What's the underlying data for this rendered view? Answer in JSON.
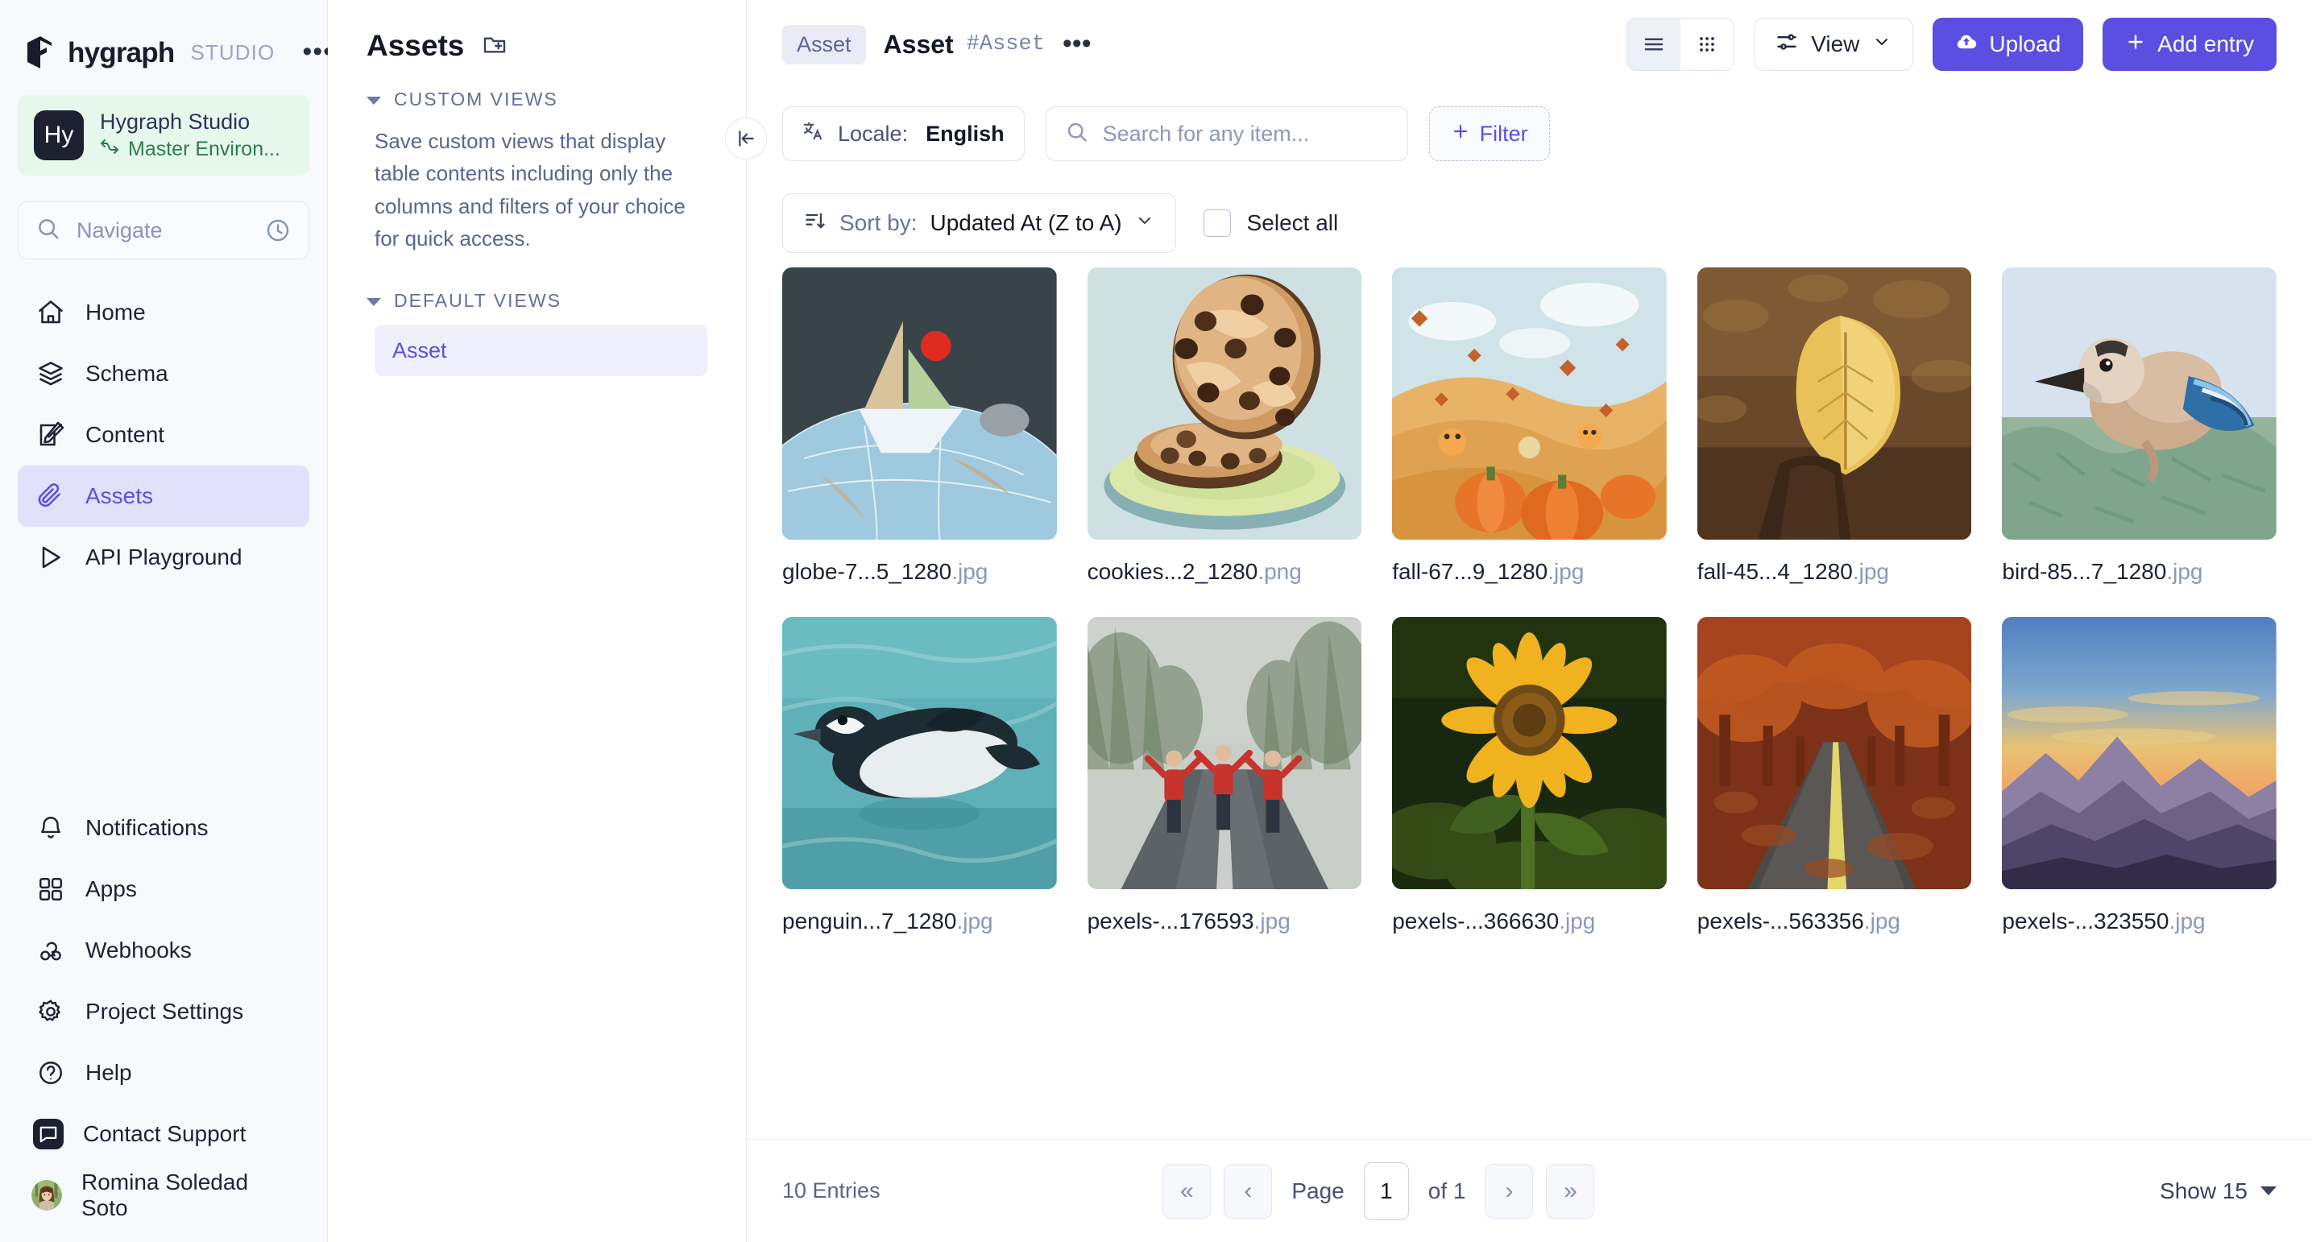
{
  "sidebar": {
    "brand": {
      "name": "hygraph",
      "suffix": "STUDIO",
      "menu_icon": "ellipsis-icon"
    },
    "project": {
      "initials": "Hy",
      "title": "Hygraph Studio",
      "environment": "Master Environ...",
      "env_color": "#2f7a4e",
      "bg_color": "#e6f7ec"
    },
    "navigate": {
      "placeholder": "Navigate",
      "search_icon": "search-icon",
      "history_icon": "clock-icon"
    },
    "items": [
      {
        "label": "Home",
        "icon": "home-icon",
        "active": false
      },
      {
        "label": "Schema",
        "icon": "layers-icon",
        "active": false
      },
      {
        "label": "Content",
        "icon": "edit-square-icon",
        "active": false
      },
      {
        "label": "Assets",
        "icon": "paperclip-icon",
        "active": true
      },
      {
        "label": "API Playground",
        "icon": "play-icon",
        "active": false
      }
    ],
    "bottom_items": [
      {
        "label": "Notifications",
        "icon": "bell-icon"
      },
      {
        "label": "Apps",
        "icon": "grid-squares-icon"
      },
      {
        "label": "Webhooks",
        "icon": "webhook-icon"
      },
      {
        "label": "Project Settings",
        "icon": "gear-icon"
      },
      {
        "label": "Help",
        "icon": "question-circle-icon"
      },
      {
        "label": "Contact Support",
        "icon": "chat-bubble-icon"
      },
      {
        "label": "Romina Soledad Soto",
        "icon": "avatar"
      }
    ],
    "active_color": "#5a4fe0",
    "active_bg": "#e2e1fb"
  },
  "views_panel": {
    "title": "Assets",
    "add_icon": "folder-plus-icon",
    "collapse_icon": "collapse-left-icon",
    "groups": [
      {
        "label": "CUSTOM VIEWS",
        "description": "Save custom views that display table contents including only the columns and filters of your choice for quick access.",
        "items": []
      },
      {
        "label": "DEFAULT VIEWS",
        "description": "",
        "items": [
          {
            "label": "Asset",
            "active": true
          }
        ]
      }
    ]
  },
  "header": {
    "breadcrumb_chip": "Asset",
    "title": "Asset",
    "hash": "#Asset",
    "more_icon": "ellipsis-icon",
    "view_mode": {
      "list_icon": "list-view-icon",
      "grid_icon": "grid-view-icon",
      "active": "grid"
    },
    "view_button": {
      "label": "View",
      "icon": "sliders-icon",
      "caret": "chevron-down-icon"
    },
    "upload_button": {
      "label": "Upload",
      "icon": "cloud-upload-icon"
    },
    "add_entry_button": {
      "label": "Add entry",
      "icon": "plus-icon"
    },
    "primary_color": "#5a4fe0"
  },
  "toolbar": {
    "locale": {
      "label": "Locale:",
      "value": "English",
      "icon": "translate-icon"
    },
    "search": {
      "value": "",
      "placeholder": "Search for any item...",
      "icon": "search-icon"
    },
    "filter": {
      "label": "Filter",
      "icon": "plus-icon"
    }
  },
  "sortbar": {
    "sort": {
      "icon": "sort-icon",
      "label": "Sort by:",
      "value": "Updated At (Z to A)",
      "caret": "chevron-down-icon"
    },
    "select_all": {
      "label": "Select all",
      "checked": false
    }
  },
  "assets": [
    {
      "name": "globe-7...5_1280",
      "ext": ".jpg",
      "thumb": "globe-paper-boat"
    },
    {
      "name": "cookies...2_1280",
      "ext": ".png",
      "thumb": "cookies-plate"
    },
    {
      "name": "fall-67...9_1280",
      "ext": ".jpg",
      "thumb": "fall-illustration"
    },
    {
      "name": "fall-45...4_1280",
      "ext": ".jpg",
      "thumb": "autumn-leaf-hand"
    },
    {
      "name": "bird-85...7_1280",
      "ext": ".jpg",
      "thumb": "jay-bird"
    },
    {
      "name": "penguin...7_1280",
      "ext": ".jpg",
      "thumb": "penguin-swim"
    },
    {
      "name": "pexels-...176593",
      "ext": ".jpg",
      "thumb": "three-people-road"
    },
    {
      "name": "pexels-...366630",
      "ext": ".jpg",
      "thumb": "sunflower"
    },
    {
      "name": "pexels-...563356",
      "ext": ".jpg",
      "thumb": "autumn-road"
    },
    {
      "name": "pexels-...323550",
      "ext": ".jpg",
      "thumb": "mountain-sunset"
    }
  ],
  "footer": {
    "entries": "10 Entries",
    "first_icon": "double-chevron-left-icon",
    "prev_icon": "chevron-left-icon",
    "page_label": "Page",
    "page_value": "1",
    "of_label": "of 1",
    "next_icon": "chevron-right-icon",
    "last_icon": "double-chevron-right-icon",
    "show": {
      "label": "Show 15",
      "caret": "chevron-down-icon"
    }
  }
}
